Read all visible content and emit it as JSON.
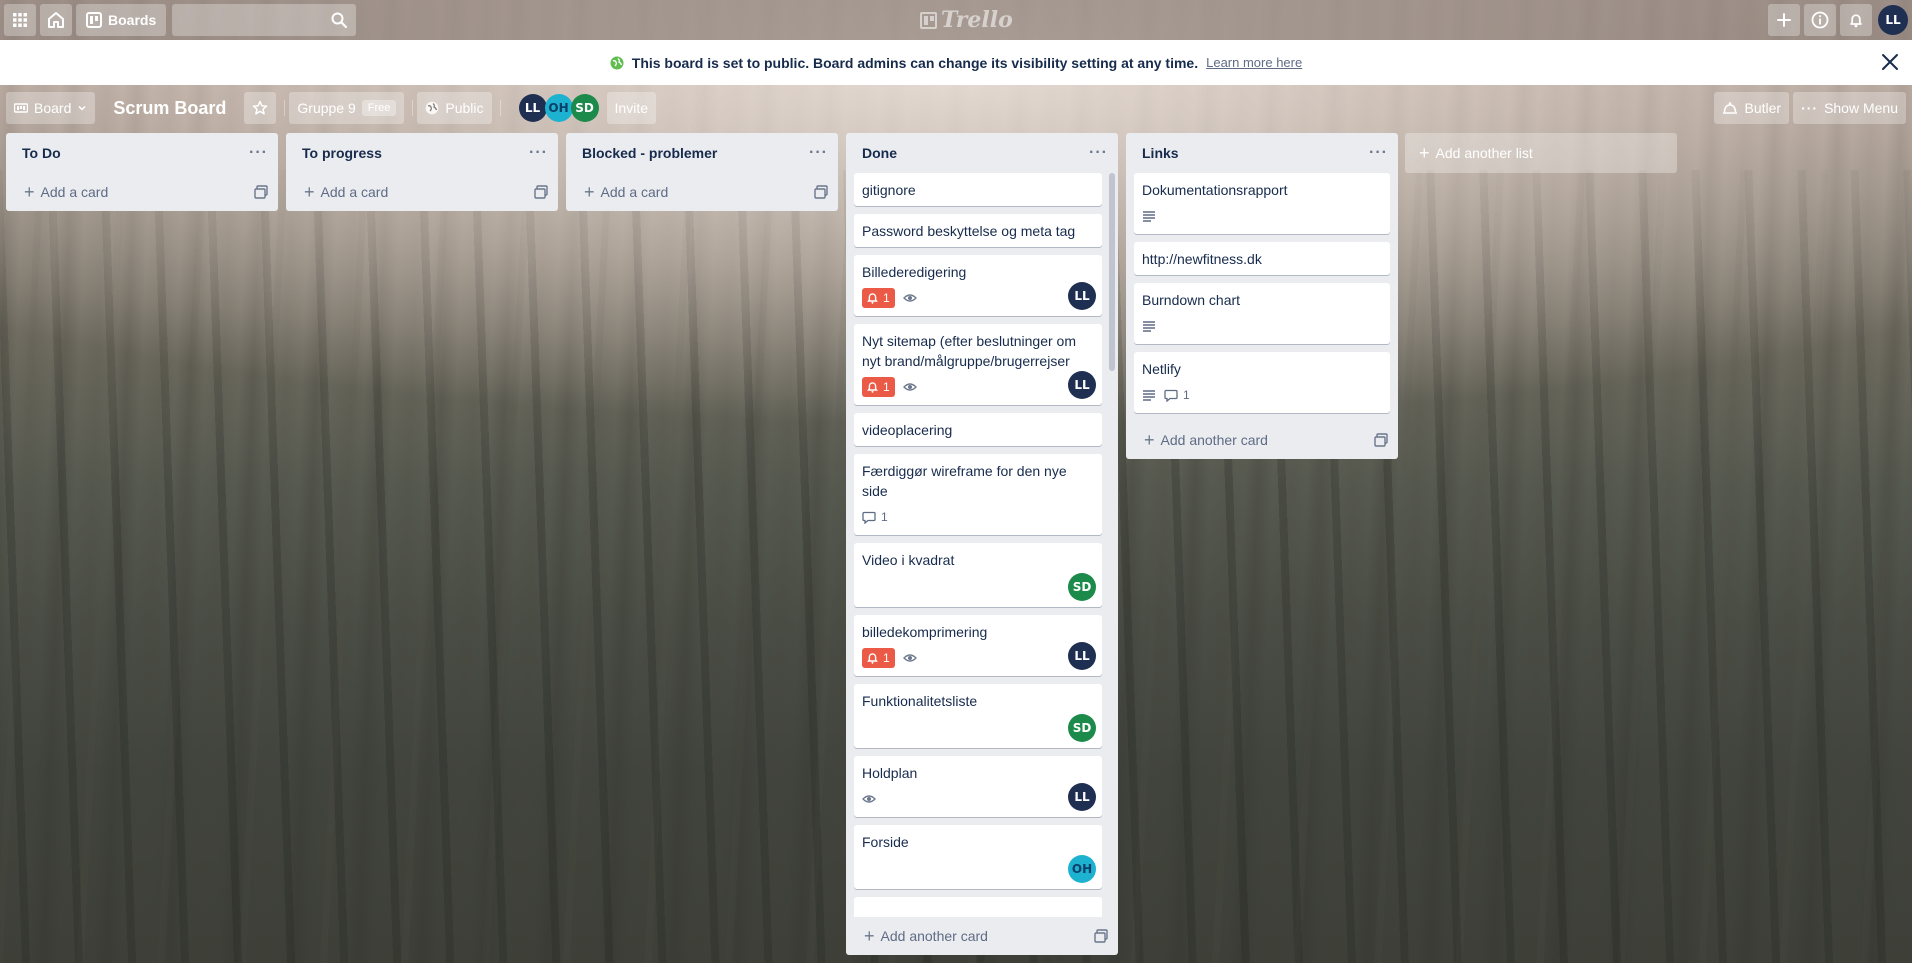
{
  "header": {
    "boards_label": "Boards",
    "logo_text": "Trello",
    "user_initials": "LL",
    "icons": [
      "apps-icon",
      "home-icon",
      "boards-icon",
      "search-icon",
      "plus-icon",
      "info-icon",
      "bell-icon"
    ]
  },
  "banner": {
    "message": "This board is set to public. Board admins can change its visibility setting at any time.",
    "link": "Learn more here"
  },
  "board": {
    "view_label": "Board",
    "title": "Scrum Board",
    "team": "Gruppe 9",
    "team_badge": "Free",
    "visibility": "Public",
    "members": [
      "LL",
      "OH",
      "SD"
    ],
    "invite_label": "Invite",
    "butler_label": "Butler",
    "show_menu_label": "Show Menu"
  },
  "lists": [
    {
      "title": "To Do",
      "add_label": "Add a card"
    },
    {
      "title": "To progress",
      "add_label": "Add a card"
    },
    {
      "title": "Blocked - problemer",
      "add_label": "Add a card"
    },
    {
      "title": "Done",
      "add_label": "Add another card",
      "cards": [
        {
          "title": "gitignore"
        },
        {
          "title": "Password beskyttelse og meta tag"
        },
        {
          "title": "Billederedigering",
          "due": "1",
          "watch": true,
          "member": "LL"
        },
        {
          "title": "Nyt sitemap (efter beslutninger om nyt brand/målgruppe/brugerrejser",
          "due": "1",
          "watch": true,
          "member": "LL"
        },
        {
          "title": "videoplacering"
        },
        {
          "title": "Færdiggør wireframe for den nye side",
          "comments": "1"
        },
        {
          "title": "Video i kvadrat",
          "member": "SD"
        },
        {
          "title": "billedekomprimering",
          "due": "1",
          "watch": true,
          "member": "LL"
        },
        {
          "title": "Funktionalitetsliste",
          "member": "SD"
        },
        {
          "title": "Holdplan",
          "watch": true,
          "member": "LL"
        },
        {
          "title": "Forside",
          "member": "OH"
        }
      ]
    },
    {
      "title": "Links",
      "add_label": "Add another card",
      "cards": [
        {
          "title": "Dokumentationsrapport",
          "description": true
        },
        {
          "title": "http://newfitness.dk"
        },
        {
          "title": "Burndown chart",
          "description": true
        },
        {
          "title": "Netlify",
          "description": true,
          "comments": "1"
        }
      ]
    }
  ],
  "add_list_label": "Add another list",
  "colors": {
    "header_bg": "#786c64",
    "list_bg": "#ebecf0",
    "due_badge": "#eb5a46",
    "avatar_ll": "#1e2f52",
    "avatar_sd": "#1b8a4a",
    "avatar_oh": "#1db3d0",
    "public_icon": "#61bd4f"
  }
}
